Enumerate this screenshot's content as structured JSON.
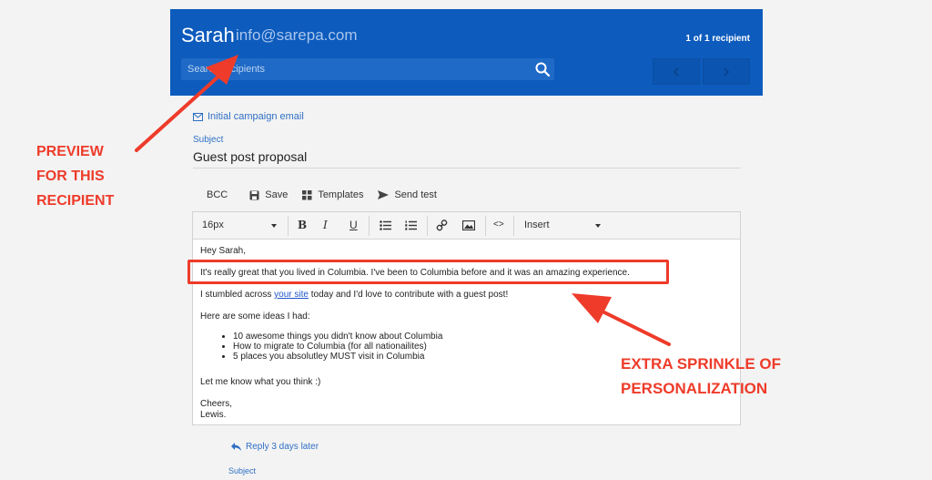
{
  "header": {
    "name": "Sarah",
    "email": "info@sarepa.com",
    "count": "1 of 1 recipient",
    "search_placeholder": "Search recipients"
  },
  "campaign": {
    "label": "Initial campaign email"
  },
  "subject": {
    "label": "Subject",
    "value": "Guest post proposal"
  },
  "toolbar": {
    "bcc": "BCC",
    "save": "Save",
    "templates": "Templates",
    "send_test": "Send test"
  },
  "format_bar": {
    "font_size": "16px",
    "insert": "Insert"
  },
  "email_body": {
    "greeting": "Hey Sarah,",
    "personal_line": "It's really great that you lived in Columbia. I've been to Columbia before and it was an amazing experience.",
    "line2_pre": "I stumbled across ",
    "line2_link": "your site",
    "line2_post": " today and I'd love to contribute with a guest post!",
    "ideas_intro": "Here are some ideas I had:",
    "ideas": [
      "10 awesome things you didn't know about Columbia",
      "How to migrate to Columbia (for all nationailites)",
      "5 places you absolutley MUST visit in Columbia"
    ],
    "closing_question": "Let me know what you think :)",
    "signoff": "Cheers,",
    "signature": "Lewis."
  },
  "followup": {
    "reply_label": "Reply 3 days later",
    "subject_label": "Subject"
  },
  "annotations": {
    "preview": [
      "PREVIEW",
      "FOR THIS",
      "RECIPIENT"
    ],
    "sprinkle": [
      "EXTRA SPRINKLE OF",
      "PERSONALIZATION"
    ]
  },
  "colors": {
    "header_blue": "#0d5bbd",
    "accent_blue": "#2f6fc4",
    "annotation_red": "#ee3b2a"
  }
}
